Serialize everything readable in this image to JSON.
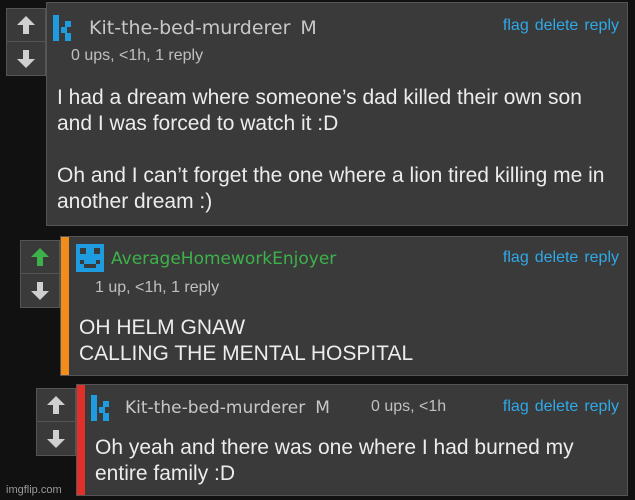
{
  "colors": {
    "link": "#2fa9e8",
    "upvote_active": "#3cb24a",
    "username_green": "#3cb24a",
    "stripe_orange": "#f28c1a",
    "stripe_red": "#e0302a",
    "avatar_blue": "#1f9be0"
  },
  "comments": [
    {
      "username": "Kit-the-bed-murderer",
      "badge": "M",
      "meta": "0 ups, <1h, 1 reply",
      "actions": {
        "flag": "flag",
        "delete": "delete",
        "reply": "reply"
      },
      "body_p1": "I had a dream where someone’s dad killed their own son and I was forced to watch it :D",
      "body_p2": "Oh and I can’t forget the one where a lion tired killing me in another dream :)",
      "upvoted": false,
      "avatar_icon": "k-letter-avatar-icon"
    },
    {
      "username": "AverageHomeworkEnjoyer",
      "meta": "1 up, <1h, 1 reply",
      "actions": {
        "flag": "flag",
        "delete": "delete",
        "reply": "reply"
      },
      "body_p1": "OH HELM GNAW",
      "body_p2": "CALLING THE MENTAL HOSPITAL",
      "upvoted": true,
      "avatar_icon": "pixel-face-avatar-icon"
    },
    {
      "username": "Kit-the-bed-murderer",
      "badge": "M",
      "meta": "0 ups, <1h",
      "actions": {
        "flag": "flag",
        "delete": "delete",
        "reply": "reply"
      },
      "body_p1": "Oh yeah and there was one where I had burned my entire family :D",
      "upvoted": false,
      "avatar_icon": "k-letter-avatar-icon"
    }
  ],
  "watermark": "imgflip.com"
}
